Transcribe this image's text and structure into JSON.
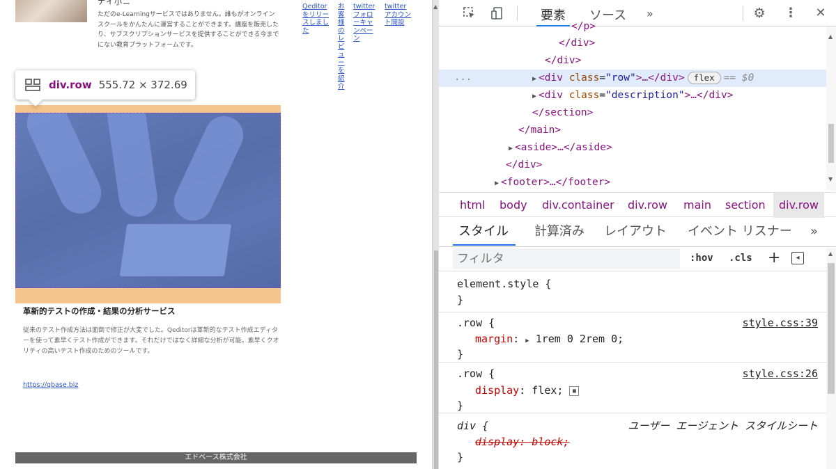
{
  "page": {
    "top_name": "ナイ小ニ",
    "intro_text": "ただのe-Learningサービスではありません。誰もがオンラインスクールをかんたんに運営することができます。講座を販売したり、サブスクリプションサービスを提供することができる今までにない教育プラットフォームです。",
    "links": [
      "Qeditorをリリースしました",
      "お客様のレビューを紹介",
      "twitterフォローキャンペーン",
      "twitterアカウント開設"
    ],
    "tooltip": {
      "element": "div.row",
      "size": "555.72 × 372.69"
    },
    "card_title": "革新的テストの作成・結果の分析サービス",
    "card_desc": "従来のテスト作成方法は面倒で修正が大変でした。Qeditorは革新的なテスト作成エディターを使って素早くテスト作成ができます。それだけではなく詳細な分析が可能。素早くクオリティの高いテスト作成のためのツールです。",
    "card_link": "https://qbase.biz",
    "footer": "エドベース株式会社"
  },
  "devtools": {
    "toolbar": {
      "tab_elements": "要素",
      "tab_sources": "ソース",
      "more": "»"
    },
    "dom": {
      "l0": "</p>",
      "l1": "</div>",
      "l2": "</div>",
      "row_tag": "<div",
      "row_attr": "class",
      "row_val": "\"row\"",
      "row_rest": ">…</div>",
      "badge": "flex",
      "dollar": "== $0",
      "desc_tag": "<div",
      "desc_attr": "class",
      "desc_val": "\"description\"",
      "desc_rest": ">…</div>",
      "l5": "</section>",
      "l6": "</main>",
      "l7": "<aside>…</aside>",
      "l8": "</div>",
      "l9": "<footer>…</footer>",
      "dots": "..."
    },
    "breadcrumbs": [
      "html",
      "body",
      "div.container",
      "div.row",
      "main",
      "section",
      "div.row"
    ],
    "subtabs": [
      "スタイル",
      "計算済み",
      "レイアウト",
      "イベント リスナー",
      "»"
    ],
    "filter": {
      "placeholder": "フィルタ",
      "hov": ":hov",
      "cls": ".cls",
      "plus": "+"
    },
    "rules": {
      "element_style": "element.style {",
      "close": "}",
      "r1_selector": ".row {",
      "r1_source": "style.css:39",
      "r1_prop": "margin",
      "r1_value": "1rem 0 2rem 0;",
      "r2_selector": ".row {",
      "r2_source": "style.css:26",
      "r2_prop": "display",
      "r2_value": "flex;",
      "r3_selector": "div {",
      "r3_source": "ユーザー エージェント スタイルシート",
      "r3_decl": "display: block;"
    }
  }
}
